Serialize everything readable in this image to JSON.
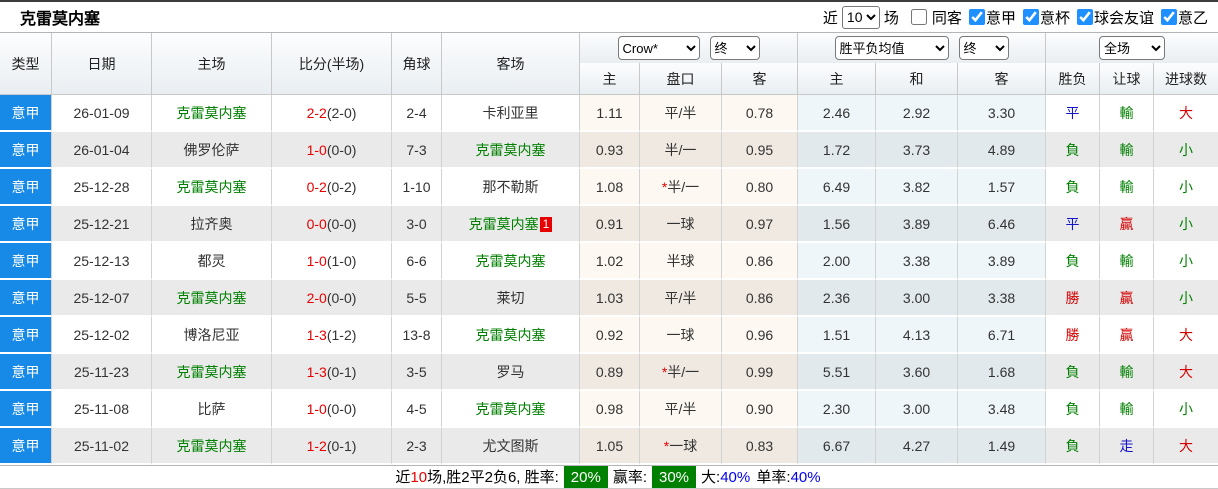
{
  "page": {
    "title": "克雷莫内塞"
  },
  "filters": {
    "near_label": "近",
    "recent_count": "10",
    "matches_label": "场",
    "same_away": {
      "label": "同客",
      "checked": false
    },
    "leagues": [
      {
        "label": "意甲",
        "checked": true
      },
      {
        "label": "意杯",
        "checked": true
      },
      {
        "label": "球会友谊",
        "checked": true
      },
      {
        "label": "意乙",
        "checked": true
      }
    ]
  },
  "table": {
    "headers": {
      "type": "类型",
      "date": "日期",
      "home": "主场",
      "score": "比分(半场)",
      "corner": "角球",
      "away": "客场",
      "odds_group": {
        "company_select": "Crow*",
        "state_select": "终"
      },
      "mean_group": {
        "type_select": "胜平负均值",
        "state_select": "终"
      },
      "result_group": {
        "scope_select": "全场"
      },
      "sub": [
        "主",
        "盘口",
        "客",
        "主",
        "和",
        "客",
        "胜负",
        "让球",
        "进球数"
      ]
    },
    "rows": [
      {
        "league": "意甲",
        "date": "26-01-09",
        "home": "克雷莫内塞",
        "home_hl": true,
        "score": "2-2",
        "half": "(2-0)",
        "corner": "2-4",
        "away": "卡利亚里",
        "away_hl": false,
        "badge": "",
        "o1": "1.11",
        "star": false,
        "hcap": "平/半",
        "o2": "0.78",
        "m1": "2.46",
        "m2": "2.92",
        "m3": "3.30",
        "r1": {
          "t": "平",
          "c": "blue"
        },
        "r2": {
          "t": "輸",
          "c": "green"
        },
        "r3": {
          "t": "大",
          "c": "red"
        }
      },
      {
        "league": "意甲",
        "date": "26-01-04",
        "home": "佛罗伦萨",
        "home_hl": false,
        "score": "1-0",
        "half": "(0-0)",
        "corner": "7-3",
        "away": "克雷莫内塞",
        "away_hl": true,
        "badge": "",
        "o1": "0.93",
        "star": false,
        "hcap": "半/一",
        "o2": "0.95",
        "m1": "1.72",
        "m2": "3.73",
        "m3": "4.89",
        "r1": {
          "t": "負",
          "c": "green"
        },
        "r2": {
          "t": "輸",
          "c": "green"
        },
        "r3": {
          "t": "小",
          "c": "green"
        }
      },
      {
        "league": "意甲",
        "date": "25-12-28",
        "home": "克雷莫内塞",
        "home_hl": true,
        "score": "0-2",
        "half": "(0-2)",
        "corner": "1-10",
        "away": "那不勒斯",
        "away_hl": false,
        "badge": "",
        "o1": "1.08",
        "star": true,
        "hcap": "半/一",
        "o2": "0.80",
        "m1": "6.49",
        "m2": "3.82",
        "m3": "1.57",
        "r1": {
          "t": "負",
          "c": "green"
        },
        "r2": {
          "t": "輸",
          "c": "green"
        },
        "r3": {
          "t": "小",
          "c": "green"
        }
      },
      {
        "league": "意甲",
        "date": "25-12-21",
        "home": "拉齐奥",
        "home_hl": false,
        "score": "0-0",
        "half": "(0-0)",
        "corner": "3-0",
        "away": "克雷莫内塞",
        "away_hl": true,
        "badge": "1",
        "o1": "0.91",
        "star": false,
        "hcap": "一球",
        "o2": "0.97",
        "m1": "1.56",
        "m2": "3.89",
        "m3": "6.46",
        "r1": {
          "t": "平",
          "c": "blue"
        },
        "r2": {
          "t": "贏",
          "c": "red"
        },
        "r3": {
          "t": "小",
          "c": "green"
        }
      },
      {
        "league": "意甲",
        "date": "25-12-13",
        "home": "都灵",
        "home_hl": false,
        "score": "1-0",
        "half": "(1-0)",
        "corner": "6-6",
        "away": "克雷莫内塞",
        "away_hl": true,
        "badge": "",
        "o1": "1.02",
        "star": false,
        "hcap": "半球",
        "o2": "0.86",
        "m1": "2.00",
        "m2": "3.38",
        "m3": "3.89",
        "r1": {
          "t": "負",
          "c": "green"
        },
        "r2": {
          "t": "輸",
          "c": "green"
        },
        "r3": {
          "t": "小",
          "c": "green"
        }
      },
      {
        "league": "意甲",
        "date": "25-12-07",
        "home": "克雷莫内塞",
        "home_hl": true,
        "score": "2-0",
        "half": "(0-0)",
        "corner": "5-5",
        "away": "莱切",
        "away_hl": false,
        "badge": "",
        "o1": "1.03",
        "star": false,
        "hcap": "平/半",
        "o2": "0.86",
        "m1": "2.36",
        "m2": "3.00",
        "m3": "3.38",
        "r1": {
          "t": "勝",
          "c": "red"
        },
        "r2": {
          "t": "贏",
          "c": "red"
        },
        "r3": {
          "t": "小",
          "c": "green"
        }
      },
      {
        "league": "意甲",
        "date": "25-12-02",
        "home": "博洛尼亚",
        "home_hl": false,
        "score": "1-3",
        "half": "(1-2)",
        "corner": "13-8",
        "away": "克雷莫内塞",
        "away_hl": true,
        "badge": "",
        "o1": "0.92",
        "star": false,
        "hcap": "一球",
        "o2": "0.96",
        "m1": "1.51",
        "m2": "4.13",
        "m3": "6.71",
        "r1": {
          "t": "勝",
          "c": "red"
        },
        "r2": {
          "t": "贏",
          "c": "red"
        },
        "r3": {
          "t": "大",
          "c": "red"
        }
      },
      {
        "league": "意甲",
        "date": "25-11-23",
        "home": "克雷莫内塞",
        "home_hl": true,
        "score": "1-3",
        "half": "(0-1)",
        "corner": "3-5",
        "away": "罗马",
        "away_hl": false,
        "badge": "",
        "o1": "0.89",
        "star": true,
        "hcap": "半/一",
        "o2": "0.99",
        "m1": "5.51",
        "m2": "3.60",
        "m3": "1.68",
        "r1": {
          "t": "負",
          "c": "green"
        },
        "r2": {
          "t": "輸",
          "c": "green"
        },
        "r3": {
          "t": "大",
          "c": "red"
        }
      },
      {
        "league": "意甲",
        "date": "25-11-08",
        "home": "比萨",
        "home_hl": false,
        "score": "1-0",
        "half": "(0-0)",
        "corner": "4-5",
        "away": "克雷莫内塞",
        "away_hl": true,
        "badge": "",
        "o1": "0.98",
        "star": false,
        "hcap": "平/半",
        "o2": "0.90",
        "m1": "2.30",
        "m2": "3.00",
        "m3": "3.48",
        "r1": {
          "t": "負",
          "c": "green"
        },
        "r2": {
          "t": "輸",
          "c": "green"
        },
        "r3": {
          "t": "小",
          "c": "green"
        }
      },
      {
        "league": "意甲",
        "date": "25-11-02",
        "home": "克雷莫内塞",
        "home_hl": true,
        "score": "1-2",
        "half": "(0-1)",
        "corner": "2-3",
        "away": "尤文图斯",
        "away_hl": false,
        "badge": "",
        "o1": "1.05",
        "star": true,
        "hcap": "一球",
        "o2": "0.83",
        "m1": "6.67",
        "m2": "4.27",
        "m3": "1.49",
        "r1": {
          "t": "負",
          "c": "green"
        },
        "r2": {
          "t": "走",
          "c": "blue"
        },
        "r3": {
          "t": "大",
          "c": "red"
        }
      }
    ]
  },
  "footer": {
    "parts": [
      {
        "t": "近",
        "c": "plain"
      },
      {
        "t": "10",
        "c": "red"
      },
      {
        "t": "场,胜2平2负6, 胜率:",
        "c": "plain"
      },
      {
        "t": "20%",
        "c": "badge"
      },
      {
        "t": "赢率:",
        "c": "plain"
      },
      {
        "t": "30%",
        "c": "badge"
      },
      {
        "t": "大:",
        "c": "plain"
      },
      {
        "t": "40%",
        "c": "blue"
      },
      {
        "t": " 单率:",
        "c": "plain"
      },
      {
        "t": "40%",
        "c": "blue"
      }
    ]
  }
}
